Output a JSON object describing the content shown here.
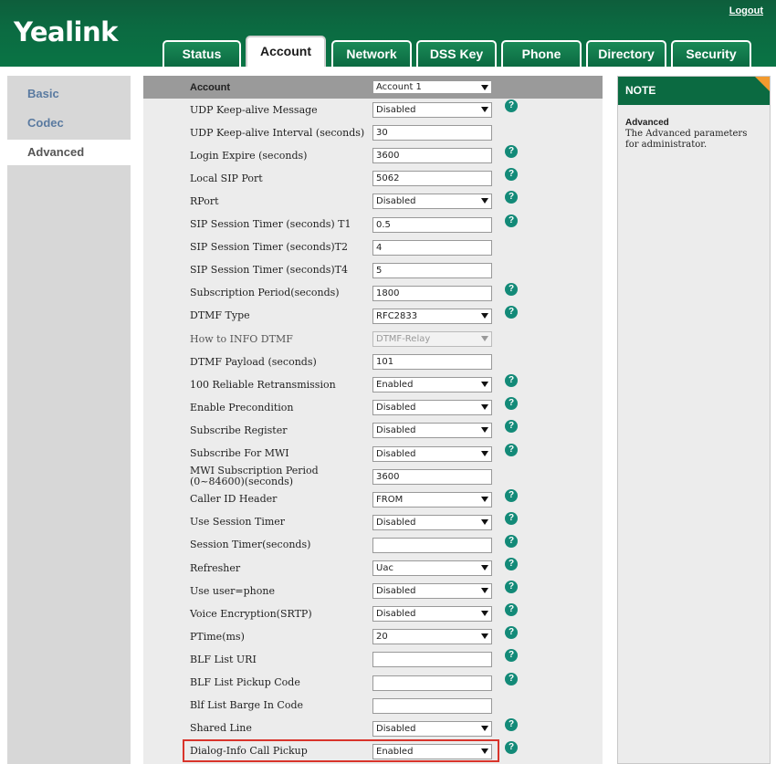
{
  "header": {
    "logo": "Yealink",
    "logout": "Logout"
  },
  "tabs": [
    "Status",
    "Account",
    "Network",
    "DSS Key",
    "Phone",
    "Directory",
    "Security"
  ],
  "sidebar": [
    "Basic",
    "Codec",
    "Advanced"
  ],
  "account_header": {
    "label": "Account",
    "value": "Account 1"
  },
  "rows": [
    {
      "label": "UDP Keep-alive Message",
      "type": "select",
      "value": "Disabled",
      "help": true
    },
    {
      "label": "UDP Keep-alive Interval (seconds)",
      "type": "input",
      "value": "30",
      "help": false
    },
    {
      "label": "Login Expire (seconds)",
      "type": "input",
      "value": "3600",
      "help": true
    },
    {
      "label": "Local SIP Port",
      "type": "input",
      "value": "5062",
      "help": true
    },
    {
      "label": "RPort",
      "type": "select",
      "value": "Disabled",
      "help": true
    },
    {
      "label": "SIP Session Timer (seconds)  T1",
      "type": "input",
      "value": "0.5",
      "help": true
    },
    {
      "label": "SIP Session Timer (seconds)T2",
      "type": "input",
      "value": "4",
      "help": false
    },
    {
      "label": "SIP Session Timer (seconds)T4",
      "type": "input",
      "value": "5",
      "help": false
    },
    {
      "label": "Subscription Period(seconds)",
      "type": "input",
      "value": "1800",
      "help": true
    },
    {
      "label": "DTMF Type",
      "type": "select",
      "value": "RFC2833",
      "help": true
    },
    {
      "label": "How to INFO DTMF",
      "type": "select-disabled",
      "value": "DTMF-Relay",
      "help": false
    },
    {
      "label": "DTMF Payload (seconds)",
      "type": "input",
      "value": "101",
      "help": false
    },
    {
      "label": "100 Reliable Retransmission",
      "type": "select",
      "value": "Enabled",
      "help": true
    },
    {
      "label": "Enable Precondition",
      "type": "select",
      "value": "Disabled",
      "help": true
    },
    {
      "label": "Subscribe Register",
      "type": "select",
      "value": "Disabled",
      "help": true
    },
    {
      "label": "Subscribe For MWI",
      "type": "select",
      "value": "Disabled",
      "help": true
    },
    {
      "label": "MWI Subscription Period (0~84600)(seconds)",
      "type": "input",
      "value": "3600",
      "help": false
    },
    {
      "label": "Caller ID Header",
      "type": "select",
      "value": "FROM",
      "help": true
    },
    {
      "label": "Use Session Timer",
      "type": "select",
      "value": "Disabled",
      "help": true
    },
    {
      "label": "Session Timer(seconds)",
      "type": "input",
      "value": "",
      "help": true
    },
    {
      "label": "Refresher",
      "type": "select",
      "value": "Uac",
      "help": true
    },
    {
      "label": "Use user=phone",
      "type": "select",
      "value": "Disabled",
      "help": true
    },
    {
      "label": "Voice Encryption(SRTP)",
      "type": "select",
      "value": "Disabled",
      "help": true
    },
    {
      "label": "PTime(ms)",
      "type": "select",
      "value": "20",
      "help": true
    },
    {
      "label": "BLF List URI",
      "type": "input",
      "value": "",
      "help": true
    },
    {
      "label": "BLF List Pickup Code",
      "type": "input",
      "value": "",
      "help": true
    },
    {
      "label": "Blf List Barge In Code",
      "type": "input",
      "value": "",
      "help": false
    },
    {
      "label": "Shared Line",
      "type": "select",
      "value": "Disabled",
      "help": true
    },
    {
      "label": "Dialog-Info Call Pickup",
      "type": "select",
      "value": "Enabled",
      "help": true
    }
  ],
  "help_glyph": "?",
  "note": {
    "heading": "NOTE",
    "title": "Advanced",
    "text": "The Advanced parameters for administrator."
  },
  "colors": {
    "brand_green": "#0b6a41",
    "help_teal": "#138a78",
    "highlight_red": "#d9342b",
    "note_corner": "#f29a2e"
  }
}
